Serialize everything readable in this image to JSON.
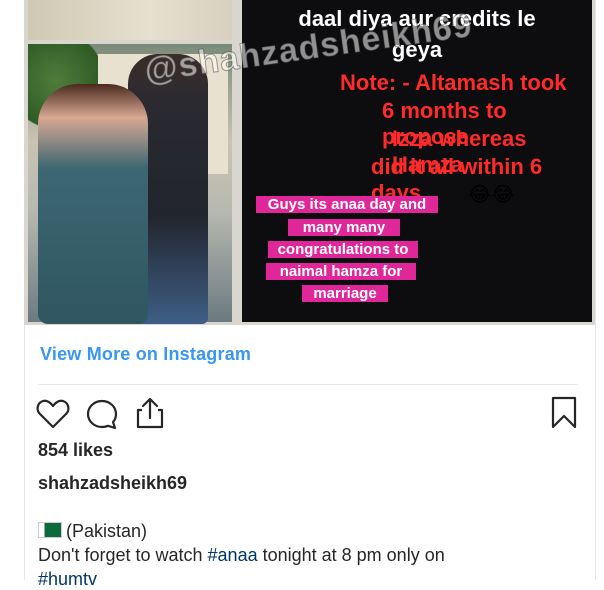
{
  "post": {
    "image": {
      "text_line1": "daal diya aur credits le",
      "text_line2": "geya",
      "note_lines": [
        "Note: - Altamash took",
        "6 months to propose",
        "Izza whereas Hamza",
        "did it all within 6 days"
      ],
      "pink_lines": [
        "Guys its anaa day and",
        "many many",
        "congratulations to",
        "naimal hamza for",
        "marriage"
      ],
      "watermark": "@shahzadsheikh69",
      "emoji": "😂😂"
    },
    "view_more_label": "View More on Instagram",
    "actions": {
      "like_icon": "heart-icon",
      "comment_icon": "comment-icon",
      "share_icon": "share-icon",
      "save_icon": "bookmark-icon"
    },
    "likes": "854 likes",
    "username": "shahzadsheikh69",
    "caption": {
      "location": "(Pakistan)",
      "text_before": "Don't forget to watch ",
      "hashtag1": "#anaa",
      "text_after": " tonight at 8 pm only on",
      "hashtag2": "#humtv"
    }
  },
  "colors": {
    "link": "#3897f0",
    "note_red": "#ff2a2a",
    "pink_box": "#e0279a",
    "hashtag": "#003569"
  }
}
